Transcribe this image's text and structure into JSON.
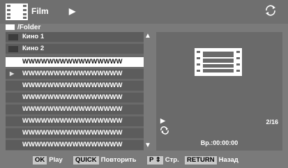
{
  "header": {
    "title": "Film",
    "play_icon": "▶",
    "repeat_icon": "repeat-icon"
  },
  "path": {
    "label": "/Folder"
  },
  "list": {
    "folders": [
      "Кино 1",
      "Кино 2"
    ],
    "files": [
      {
        "label": "WWWWWWWWWWWWWWWW",
        "selected": true,
        "playing": false
      },
      {
        "label": "WWWWWWWWWWWWWWWW",
        "selected": false,
        "playing": true
      },
      {
        "label": "WWWWWWWWWWWWWWWW",
        "selected": false,
        "playing": false
      },
      {
        "label": "WWWWWWWWWWWWWWWW",
        "selected": false,
        "playing": false
      },
      {
        "label": "WWWWWWWWWWWWWWWW",
        "selected": false,
        "playing": false
      },
      {
        "label": "WWWWWWWWWWWWWWWW",
        "selected": false,
        "playing": false
      },
      {
        "label": "WWWWWWWWWWWWWWWW",
        "selected": false,
        "playing": false
      },
      {
        "label": "WWWWWWWWWWWWWWWW",
        "selected": false,
        "playing": false
      },
      {
        "label": "WWWWWWWWWWWWWWWW",
        "selected": false,
        "playing": false
      }
    ]
  },
  "info": {
    "play": "▶",
    "count": "2/16",
    "time": "Вр.:00:00:00"
  },
  "footer": {
    "ok_key": "OK",
    "ok_label": "Play",
    "quick_key": "QUICK",
    "quick_label": "Повторить",
    "p_key": "P ⇕",
    "p_label": "Стр.",
    "return_key": "RETURN",
    "return_label": "Назад"
  }
}
